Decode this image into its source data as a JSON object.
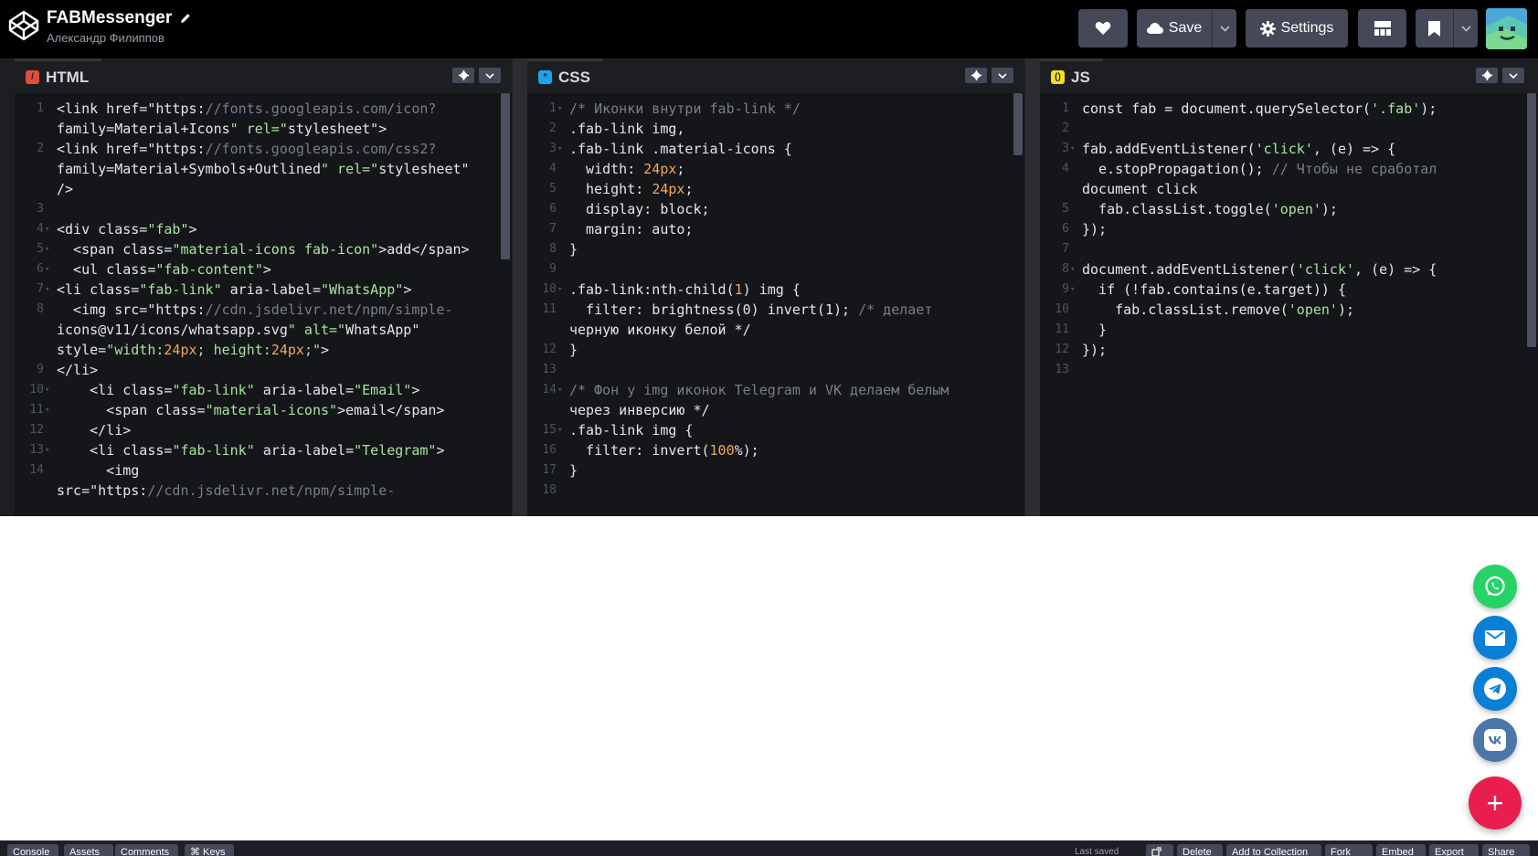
{
  "header": {
    "pen_title": "FABMessenger",
    "author": "Александр Филиппов",
    "save_label": "Save",
    "settings_label": "Settings"
  },
  "panels": {
    "html": {
      "label": "HTML",
      "lines": [
        {
          "n": "1",
          "fold": "",
          "text": "<link href=\"https://fonts.googleapis.com/icon?"
        },
        {
          "n": "",
          "fold": "",
          "text": "family=Material+Icons\" rel=\"stylesheet\">"
        },
        {
          "n": "2",
          "fold": "",
          "text": "<link href=\"https://fonts.googleapis.com/css2?"
        },
        {
          "n": "",
          "fold": "",
          "text": "family=Material+Symbols+Outlined\" rel=\"stylesheet\""
        },
        {
          "n": "",
          "fold": "",
          "text": "/>"
        },
        {
          "n": "3",
          "fold": "",
          "text": ""
        },
        {
          "n": "4",
          "fold": "▾",
          "text": "<div class=\"fab\">"
        },
        {
          "n": "5",
          "fold": "▾",
          "text": "  <span class=\"material-icons fab-icon\">add</span>"
        },
        {
          "n": "6",
          "fold": "▾",
          "text": "  <ul class=\"fab-content\">"
        },
        {
          "n": "7",
          "fold": "▾",
          "text": "<li class=\"fab-link\" aria-label=\"WhatsApp\">"
        },
        {
          "n": "8",
          "fold": "",
          "text": "  <img src=\"https://cdn.jsdelivr.net/npm/simple-"
        },
        {
          "n": "",
          "fold": "",
          "text": "icons@v11/icons/whatsapp.svg\" alt=\"WhatsApp\""
        },
        {
          "n": "",
          "fold": "",
          "text": "style=\"width:24px; height:24px;\">"
        },
        {
          "n": "9",
          "fold": "",
          "text": "</li>"
        },
        {
          "n": "10",
          "fold": "▾",
          "text": "    <li class=\"fab-link\" aria-label=\"Email\">"
        },
        {
          "n": "11",
          "fold": "▾",
          "text": "      <span class=\"material-icons\">email</span>"
        },
        {
          "n": "12",
          "fold": "",
          "text": "    </li>"
        },
        {
          "n": "13",
          "fold": "▾",
          "text": "    <li class=\"fab-link\" aria-label=\"Telegram\">"
        },
        {
          "n": "14",
          "fold": "",
          "text": "      <img"
        },
        {
          "n": "",
          "fold": "",
          "text": "src=\"https://cdn.jsdelivr.net/npm/simple-"
        }
      ]
    },
    "css": {
      "label": "CSS",
      "lines": [
        {
          "n": "1",
          "fold": "▾",
          "text": "/* Иконки внутри fab-link */"
        },
        {
          "n": "2",
          "fold": "",
          "text": ".fab-link img,"
        },
        {
          "n": "3",
          "fold": "▾",
          "text": ".fab-link .material-icons {"
        },
        {
          "n": "4",
          "fold": "",
          "text": "  width: 24px;"
        },
        {
          "n": "5",
          "fold": "",
          "text": "  height: 24px;"
        },
        {
          "n": "6",
          "fold": "",
          "text": "  display: block;"
        },
        {
          "n": "7",
          "fold": "",
          "text": "  margin: auto;"
        },
        {
          "n": "8",
          "fold": "",
          "text": "}"
        },
        {
          "n": "9",
          "fold": "",
          "text": ""
        },
        {
          "n": "10",
          "fold": "▾",
          "text": ".fab-link:nth-child(1) img {"
        },
        {
          "n": "11",
          "fold": "",
          "text": "  filter: brightness(0) invert(1); /* делает"
        },
        {
          "n": "",
          "fold": "",
          "text": "черную иконку белой */"
        },
        {
          "n": "12",
          "fold": "",
          "text": "}"
        },
        {
          "n": "13",
          "fold": "",
          "text": ""
        },
        {
          "n": "14",
          "fold": "▾",
          "text": "/* Фон у img иконок Telegram и VK делаем белым"
        },
        {
          "n": "",
          "fold": "",
          "text": "через инверсию */"
        },
        {
          "n": "15",
          "fold": "▾",
          "text": ".fab-link img {"
        },
        {
          "n": "16",
          "fold": "",
          "text": "  filter: invert(100%);"
        },
        {
          "n": "17",
          "fold": "",
          "text": "}"
        },
        {
          "n": "18",
          "fold": "",
          "text": ""
        }
      ]
    },
    "js": {
      "label": "JS",
      "lines": [
        {
          "n": "1",
          "fold": "",
          "text": "const fab = document.querySelector('.fab');"
        },
        {
          "n": "2",
          "fold": "",
          "text": ""
        },
        {
          "n": "3",
          "fold": "▾",
          "text": "fab.addEventListener('click', (e) => {"
        },
        {
          "n": "4",
          "fold": "",
          "text": "  e.stopPropagation(); // Чтобы не сработал"
        },
        {
          "n": "",
          "fold": "",
          "text": "document click"
        },
        {
          "n": "5",
          "fold": "",
          "text": "  fab.classList.toggle('open');"
        },
        {
          "n": "6",
          "fold": "",
          "text": "});"
        },
        {
          "n": "7",
          "fold": "",
          "text": ""
        },
        {
          "n": "8",
          "fold": "▾",
          "text": "document.addEventListener('click', (e) => {"
        },
        {
          "n": "9",
          "fold": "▾",
          "text": "  if (!fab.contains(e.target)) {"
        },
        {
          "n": "10",
          "fold": "",
          "text": "    fab.classList.remove('open');"
        },
        {
          "n": "11",
          "fold": "",
          "text": "  }"
        },
        {
          "n": "12",
          "fold": "",
          "text": "});"
        },
        {
          "n": "13",
          "fold": "",
          "text": ""
        }
      ]
    }
  },
  "preview": {
    "fab_items": [
      {
        "name": "whatsapp",
        "color": "#25d366"
      },
      {
        "name": "email",
        "color": "#0a7fd6"
      },
      {
        "name": "telegram",
        "color": "#0a7fd6"
      },
      {
        "name": "vk",
        "color": "#4a76a8"
      }
    ],
    "fab_main_label": "+",
    "fab_main_color": "#e91e4e"
  },
  "footer": {
    "console": "Console",
    "assets": "Assets",
    "comments": "Comments",
    "keys": "⌘ Keys",
    "last_saved": "Last saved",
    "delete": "Delete",
    "add_to_collection": "Add to Collection",
    "fork": "Fork",
    "embed": "Embed",
    "export": "Export",
    "share": "Share"
  }
}
